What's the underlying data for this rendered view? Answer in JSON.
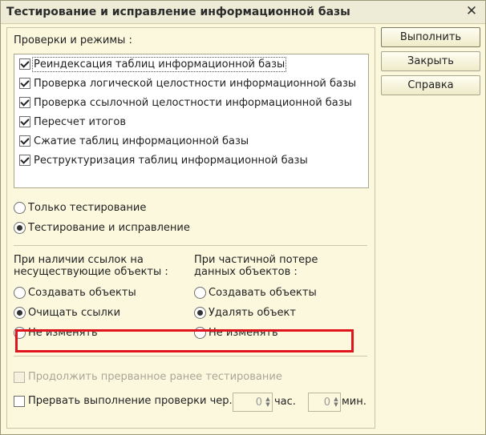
{
  "window": {
    "title": "Тестирование и исправление информационной базы",
    "close_glyph": "✕"
  },
  "checks": {
    "label": "Проверки и режимы :",
    "items": [
      {
        "label": "Реиндексация таблиц информационной базы",
        "checked": true
      },
      {
        "label": "Проверка логической целостности информационной базы",
        "checked": true
      },
      {
        "label": "Проверка ссылочной целостности информационной базы",
        "checked": true
      },
      {
        "label": "Пересчет итогов",
        "checked": true
      },
      {
        "label": "Сжатие таблиц информационной базы",
        "checked": true
      },
      {
        "label": "Реструктуризация таблиц информационной базы",
        "checked": true
      }
    ]
  },
  "mode": {
    "test_only": "Только тестирование",
    "test_and_fix": "Тестирование и исправление",
    "selected": "test_and_fix"
  },
  "missing_refs": {
    "label_line1": "При наличии ссылок на",
    "label_line2": "несуществующие объекты :",
    "options": [
      "Создавать объекты",
      "Очищать ссылки",
      "Не изменять"
    ],
    "selected_index": 1
  },
  "partial_loss": {
    "label_line1": "При частичной потере",
    "label_line2": "данных объектов :",
    "options": [
      "Создавать объекты",
      "Удалять объект",
      "Не изменять"
    ],
    "selected_index": 1
  },
  "continue_interrupted": {
    "label": "Продолжить прерванное ранее тестирование",
    "enabled": false
  },
  "interrupt": {
    "label": "Прервать выполнение проверки чер...",
    "hours_value": "0",
    "hours_unit": "час.",
    "minutes_value": "0",
    "minutes_unit": "мин."
  },
  "buttons": {
    "run": "Выполнить",
    "close": "Закрыть",
    "help": "Справка"
  },
  "colors": {
    "window_bg": "#fbf8de",
    "highlight": "#e1141e"
  }
}
